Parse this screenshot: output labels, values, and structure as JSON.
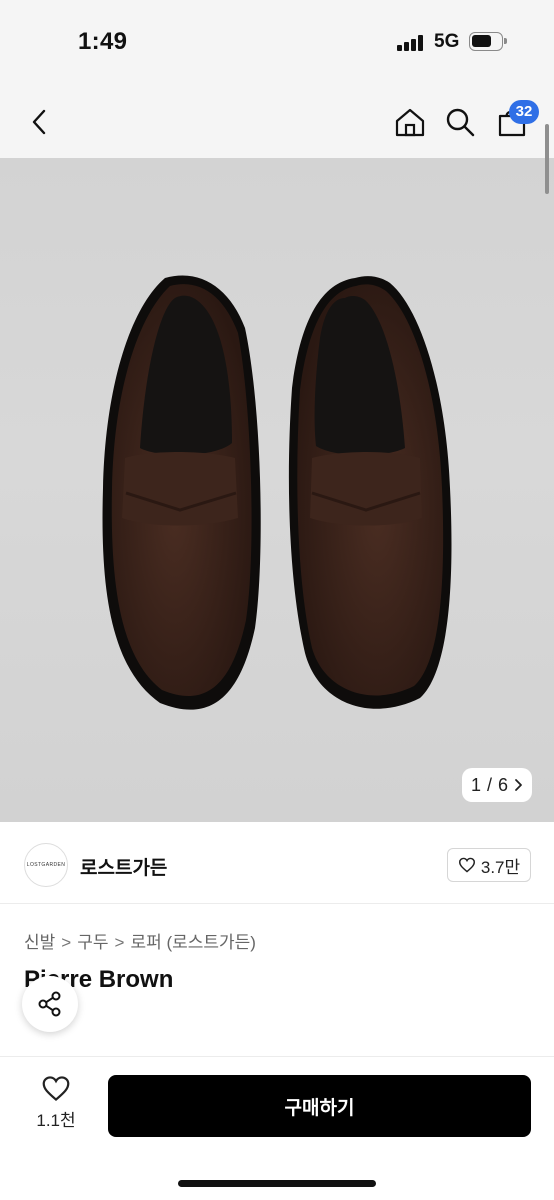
{
  "status_bar": {
    "time": "1:49",
    "network": "5G",
    "signal_bars": 4,
    "battery_level": 0.6
  },
  "header": {
    "back_icon": "chevron-left-icon",
    "home_icon": "home-icon",
    "search_icon": "search-icon",
    "bag_icon": "shopping-bag-icon",
    "cart_count": "32"
  },
  "gallery": {
    "current": "1",
    "separator": "/",
    "total": "6",
    "next_icon": "chevron-right-icon"
  },
  "brand": {
    "logo_text": "LOSTGARDEN",
    "name": "로스트가든",
    "likes": "3.7만",
    "heart_icon": "heart-icon"
  },
  "breadcrumb": {
    "items": [
      "신발",
      "구두",
      "로퍼 (로스트가든)"
    ],
    "separator": ">"
  },
  "product": {
    "title": "Pierre Brown"
  },
  "share": {
    "icon": "share-icon"
  },
  "bottom_bar": {
    "likes": "1.1천",
    "buy_label": "구매하기"
  },
  "colors": {
    "accent": "#2f6fe6",
    "cta_bg": "#000000",
    "product_tag": "#e85b3f"
  }
}
